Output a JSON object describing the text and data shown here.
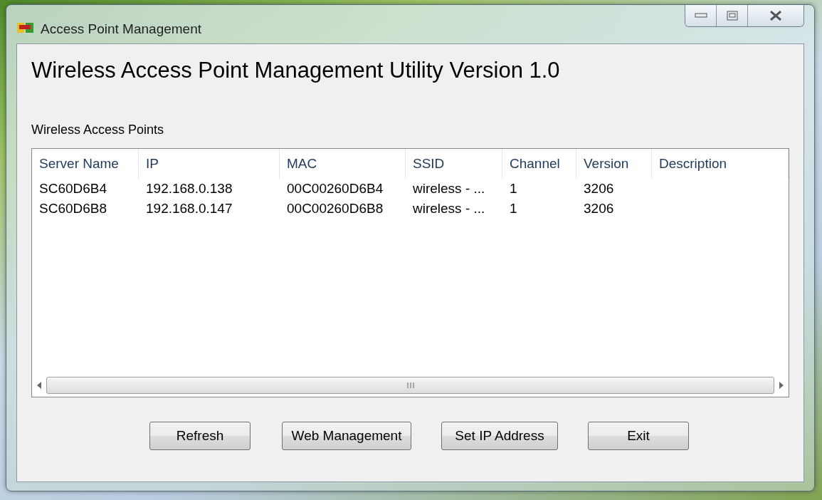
{
  "window": {
    "title": "Access Point Management"
  },
  "heading": "Wireless Access Point Management Utility Version 1.0",
  "list_label": "Wireless Access Points",
  "table": {
    "columns": [
      "Server Name",
      "IP",
      "MAC",
      "SSID",
      "Channel",
      "Version",
      "Description"
    ],
    "rows": [
      {
        "cells": [
          "SC60D6B4",
          "192.168.0.138",
          "00C00260D6B4",
          "wireless - ...",
          "1",
          "3206",
          ""
        ]
      },
      {
        "cells": [
          "SC60D6B8",
          "192.168.0.147",
          "00C00260D6B8",
          "wireless - ...",
          "1",
          "3206",
          ""
        ]
      }
    ]
  },
  "buttons": [
    "Refresh",
    "Web Management",
    "Set IP Address",
    "Exit"
  ]
}
